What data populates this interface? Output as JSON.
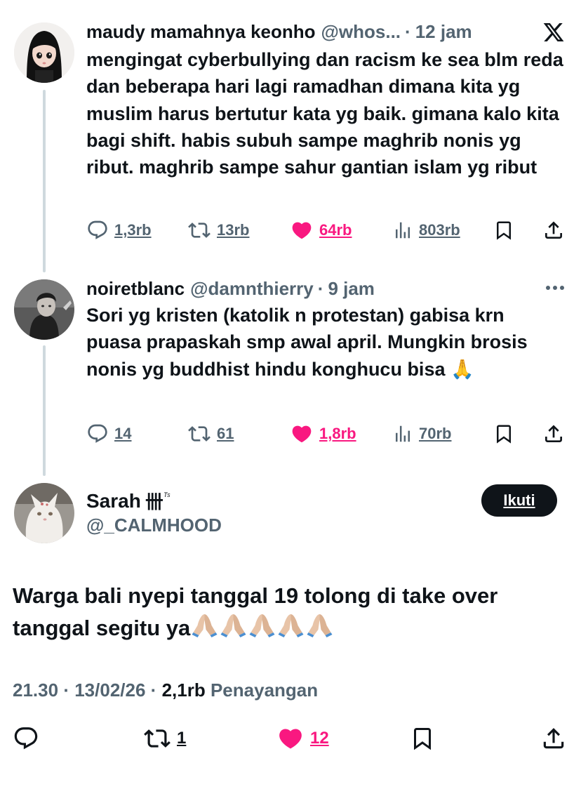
{
  "tweets": [
    {
      "name": "maudy mamahnya keonho",
      "handle": "@whos...",
      "separator": "·",
      "time": "12 jam",
      "text": "mengingat cyberbullying dan racism ke sea blm reda dan beberapa hari lagi ramadhan dimana kita yg muslim harus bertutur kata yg baik. gimana kalo kita bagi shift. habis subuh sampe maghrib nonis yg ribut. maghrib sampe sahur gantian islam yg ribut",
      "replies": "1,3rb",
      "reposts": "13rb",
      "likes": "64rb",
      "views": "803rb"
    },
    {
      "name": "noiretblanc",
      "handle": "@damnthierry",
      "separator": "·",
      "time": "9 jam",
      "text": "Sori yg kristen (katolik n protestan) gabisa krn puasa prapaskah smp awal april. Mungkin brosis nonis yg buddhist hindu konghucu bisa 🙏",
      "replies": "14",
      "reposts": "61",
      "likes": "1,8rb",
      "views": "70rb"
    }
  ],
  "main": {
    "name": "Sarah",
    "name_tally": "卌",
    "name_sup": "ᵀˢ",
    "handle": "@_CALMHOOD",
    "follow_label": "Ikuti",
    "text": "Warga bali nyepi tanggal 19 tolong di take over tanggal segitu ya",
    "time": "21.30",
    "separator": "·",
    "date": "13/02/26",
    "views": "2,1rb",
    "views_label": "Penayangan",
    "reposts": "1",
    "likes": "12"
  },
  "icons": {
    "reply": "reply-icon",
    "repost": "repost-icon",
    "like": "heart-icon",
    "views": "views-icon",
    "bookmark": "bookmark-icon",
    "share": "share-icon",
    "x_logo": "x-logo-icon",
    "more": "more-icon",
    "pray": "folded-hands-emoji"
  },
  "colors": {
    "text": "#0f1419",
    "secondary": "#536471",
    "like": "#f91880",
    "thread_line": "#cfd9de",
    "follow_bg": "#0f1419"
  }
}
